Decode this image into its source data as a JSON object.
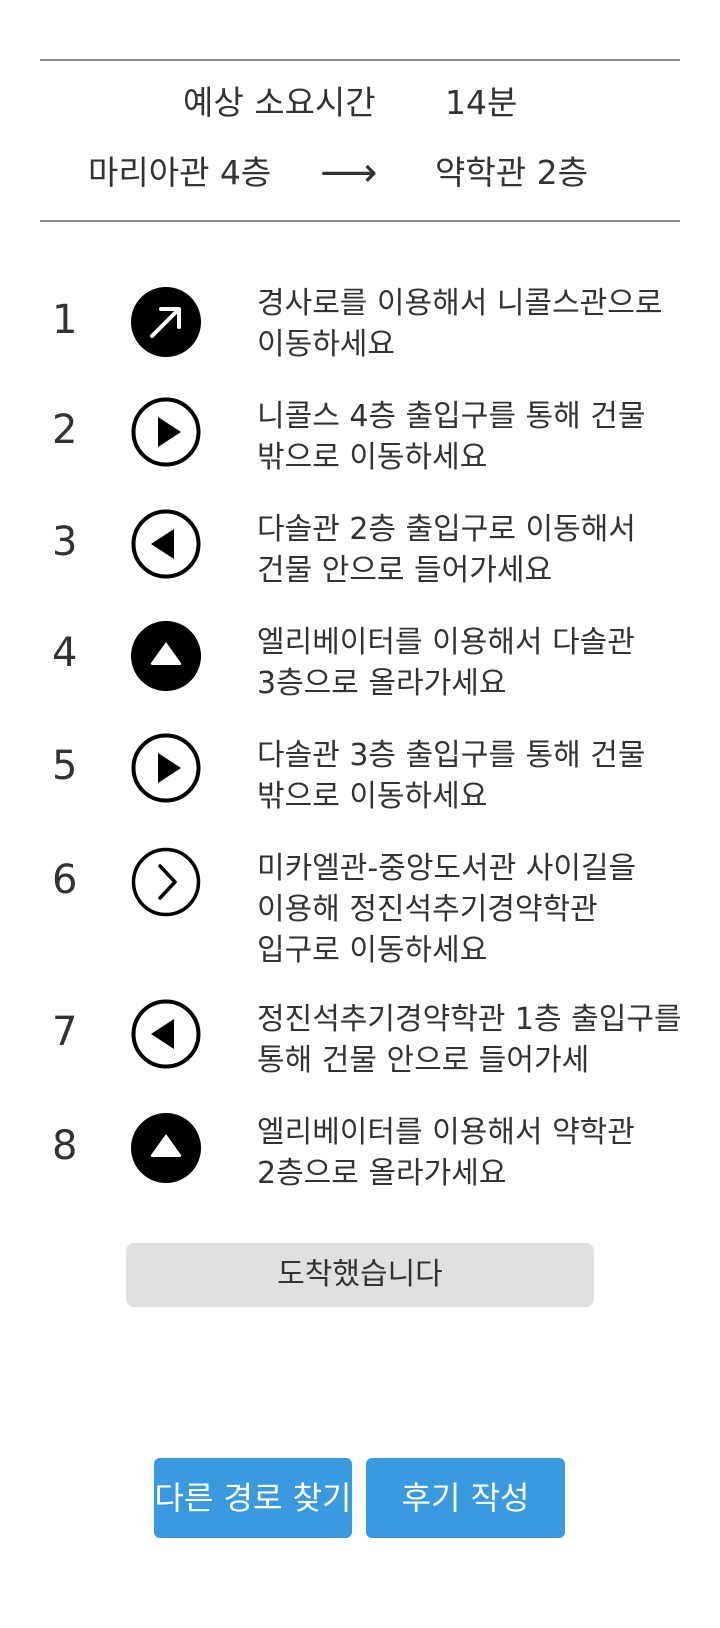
{
  "summary": {
    "time_label": "예상 소요시간",
    "time_value": "14분",
    "origin": "마리아관 4층",
    "arrow": "⟶",
    "destination": "약학관 2층"
  },
  "steps": [
    {
      "num": "1",
      "icon": "arrow-up-right-icon",
      "text": "경사로를 이용해서 니콜스관으로 이동하세요"
    },
    {
      "num": "2",
      "icon": "play-circle-icon",
      "text": "니콜스 4층 출입구를 통해 건물 밖으로 이동하세요"
    },
    {
      "num": "3",
      "icon": "reverse-circle-icon",
      "text": "다솔관 2층 출입구로 이동해서 건물 안으로 들어가세요"
    },
    {
      "num": "4",
      "icon": "up-triangle-icon",
      "text": "엘리베이터를 이용해서 다솔관 3층으로 올라가세요"
    },
    {
      "num": "5",
      "icon": "play-circle-icon",
      "text": "다솔관 3층 출입구를 통해 건물 밖으로 이동하세요"
    },
    {
      "num": "6",
      "icon": "chevron-right-circle-icon",
      "text": "미카엘관-중앙도서관 사이길을 이용해 정진석추기경약학관 입구로 이동하세요"
    },
    {
      "num": "7",
      "icon": "reverse-circle-icon",
      "text": "정진석추기경약학관 1층 출입구를 통해 건물 안으로 들어가세"
    },
    {
      "num": "8",
      "icon": "up-triangle-icon",
      "text": "엘리베이터를 이용해서 약학관 2층으로 올라가세요"
    }
  ],
  "arrived_button": "도착했습니다",
  "other_route_button": "다른 경로 찾기",
  "review_button": "후기 작성",
  "colors": {
    "accent": "#3a9ae0",
    "text": "#333333",
    "arrived_bg": "#e0e0e0",
    "divider": "#8a8a8a"
  }
}
